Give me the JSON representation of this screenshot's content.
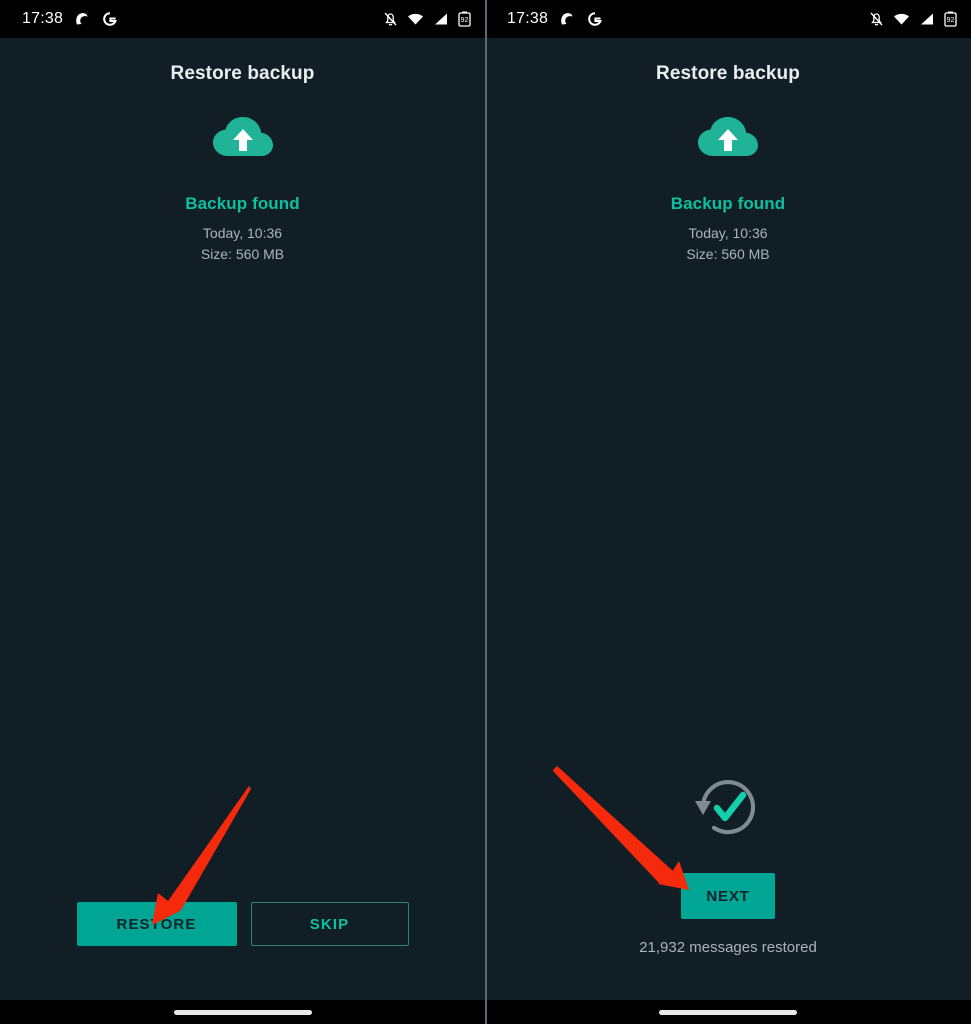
{
  "accent": {
    "teal": "#00a693",
    "teal_text": "#0fbf9f",
    "background": "#111e26",
    "statusbar": "#000000",
    "arrow_red": "#f52a0c",
    "secondary_text": "#aab4ba",
    "title_text": "#e9eef1",
    "button_text_dark": "#15232b",
    "outline_border": "#2c8377",
    "done_ring_gray": "#7e8b92",
    "divider": "#5b6b75"
  },
  "panels": [
    {
      "id": "left",
      "statusbar": {
        "time": "17:38",
        "notification_icons": [
          "app-notification-icon",
          "google-icon"
        ],
        "system_icons": [
          "notifications-silenced-icon",
          "wifi-icon",
          "cellular-signal-icon",
          "battery-icon"
        ],
        "battery_level": "92"
      },
      "title": "Restore backup",
      "status_icon": "cloud-upload-icon",
      "status_heading": "Backup found",
      "backup_date": "Today, 10:36",
      "backup_size": "Size: 560 MB",
      "buttons": [
        {
          "label": "RESTORE",
          "style": "filled"
        },
        {
          "label": "SKIP",
          "style": "outline"
        }
      ],
      "annotation": {
        "type": "arrow",
        "points_to": "RESTORE",
        "color": "#f52a0c"
      }
    },
    {
      "id": "right",
      "statusbar": {
        "time": "17:38",
        "notification_icons": [
          "app-notification-icon",
          "google-icon"
        ],
        "system_icons": [
          "notifications-silenced-icon",
          "wifi-icon",
          "cellular-signal-icon",
          "battery-icon"
        ],
        "battery_level": "92"
      },
      "title": "Restore backup",
      "status_icon": "cloud-upload-icon",
      "status_heading": "Backup found",
      "backup_date": "Today, 10:36",
      "backup_size": "Size: 560 MB",
      "done_icon": "restore-complete-check-icon",
      "next_button": {
        "label": "NEXT",
        "style": "filled"
      },
      "restored_count_text": "21,932 messages restored",
      "annotation": {
        "type": "arrow",
        "points_to": "NEXT",
        "color": "#f52a0c"
      }
    }
  ]
}
